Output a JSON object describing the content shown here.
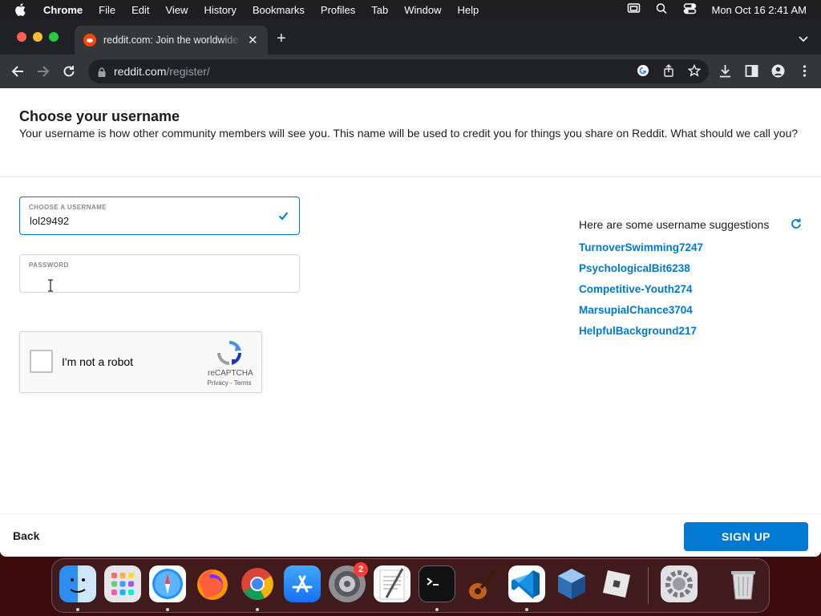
{
  "menubar": {
    "app": "Chrome",
    "items": [
      "File",
      "Edit",
      "View",
      "History",
      "Bookmarks",
      "Profiles",
      "Tab",
      "Window",
      "Help"
    ],
    "clock": "Mon Oct 16  2:41 AM"
  },
  "browser": {
    "tab_title": "reddit.com: Join the worldwide conversation",
    "url_host": "reddit.com",
    "url_path": "/register/"
  },
  "page": {
    "heading": "Choose your username",
    "description": "Your username is how other community members will see you. This name will be used to credit you for things you share on Reddit. What should we call you?",
    "username_label": "CHOOSE A USERNAME",
    "username_value": "lol29492",
    "password_label": "PASSWORD",
    "password_value": "",
    "recaptcha": {
      "label": "I'm not a robot",
      "brand": "reCAPTCHA",
      "privacy": "Privacy",
      "separator": " - ",
      "terms": "Terms"
    },
    "suggestions_heading": "Here are some username suggestions",
    "suggestions": [
      "TurnoverSwimming7247",
      "PsychologicalBit6238",
      "Competitive-Youth274",
      "MarsupialChance3704",
      "HelpfulBackground217"
    ],
    "back_label": "Back",
    "signup_label": "SIGN UP"
  },
  "dock": {
    "apps": [
      "finder",
      "launchpad",
      "safari",
      "firefox",
      "chrome",
      "app-store",
      "system-preferences",
      "textedit",
      "terminal",
      "garageband",
      "vscode",
      "virtualbox",
      "roblox",
      "settings-utility",
      "trash"
    ],
    "system_preferences_badge": "2"
  },
  "colors": {
    "accent": "#0079d3",
    "reddit_orange": "#ff4500"
  }
}
